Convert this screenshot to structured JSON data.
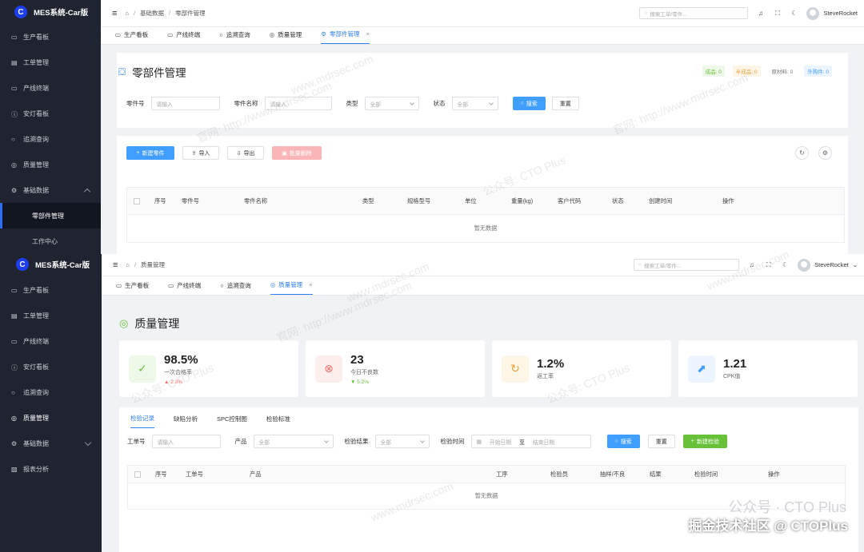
{
  "app_title": "MES系统-Car版",
  "logo_letter": "C",
  "colors": {
    "accent": "#409eff",
    "sidebar": "#1f2430",
    "success": "#67c23a",
    "danger": "#f56c6c"
  },
  "search_placeholder": "搜索工单/零件...",
  "user_name": "SteveRocket",
  "w1": {
    "sidebar": [
      {
        "label": "生产看板",
        "icon": "monitor-icon"
      },
      {
        "label": "工单管理",
        "icon": "document-icon"
      },
      {
        "label": "产线终端",
        "icon": "screen-icon"
      },
      {
        "label": "安灯看板",
        "icon": "alert-icon"
      },
      {
        "label": "追溯查询",
        "icon": "search-icon"
      },
      {
        "label": "质量管理",
        "icon": "check-circle-icon"
      },
      {
        "label": "基础数据",
        "icon": "gear-icon"
      }
    ],
    "sub_items": [
      "零部件管理",
      "工作中心"
    ],
    "breadcrumb": [
      "基础数据",
      "零部件管理"
    ],
    "tabs": [
      "生产看板",
      "产线终端",
      "追溯查询",
      "质量管理",
      "零部件管理"
    ],
    "page_title": "零部件管理",
    "stats": [
      {
        "label": "成品: 0",
        "color": "#67c23a",
        "bg": "#eef8e8"
      },
      {
        "label": "半成品: 0",
        "color": "#e6a23c",
        "bg": "#fdf5e6"
      },
      {
        "label": "原材料: 0",
        "color": "#777777",
        "bg": "#ffffff"
      },
      {
        "label": "外购件: 0",
        "color": "#409eff",
        "bg": "#ecf5ff"
      }
    ],
    "filters": {
      "part_no": {
        "label": "零件号",
        "placeholder": "请输入"
      },
      "part_name": {
        "label": "零件名称",
        "placeholder": "请输入"
      },
      "type": {
        "label": "类型",
        "value": "全部"
      },
      "status": {
        "label": "状态",
        "value": "全部"
      },
      "search_btn": "搜索",
      "reset_btn": "重置"
    },
    "actions": {
      "new": "新建零件",
      "import": "导入",
      "export": "导出",
      "batch_delete": "批量删除"
    },
    "columns": [
      "序号",
      "零件号",
      "零件名称",
      "类型",
      "规格型号",
      "单位",
      "重量(kg)",
      "客户代码",
      "状态",
      "创建时间",
      "操作"
    ],
    "empty_text": "暂无数据"
  },
  "w2": {
    "sidebar": [
      {
        "label": "生产看板",
        "icon": "monitor-icon"
      },
      {
        "label": "工单管理",
        "icon": "document-icon"
      },
      {
        "label": "产线终端",
        "icon": "screen-icon"
      },
      {
        "label": "安灯看板",
        "icon": "alert-icon"
      },
      {
        "label": "追溯查询",
        "icon": "search-icon"
      },
      {
        "label": "质量管理",
        "icon": "check-circle-icon"
      },
      {
        "label": "基础数据",
        "icon": "gear-icon"
      },
      {
        "label": "报表分析",
        "icon": "chart-icon"
      }
    ],
    "breadcrumb": [
      "质量管理"
    ],
    "tabs": [
      "生产看板",
      "产线终端",
      "追溯查询",
      "质量管理"
    ],
    "page_title": "质量管理",
    "kpis": [
      {
        "value": "98.5%",
        "label": "一次合格率",
        "trend": "2.3%",
        "dir": "up",
        "icon": "check-circle-icon",
        "fg": "#67c23a",
        "bg": "#eef8e8"
      },
      {
        "value": "23",
        "label": "今日不良数",
        "trend": "5.2%",
        "dir": "down",
        "icon": "close-circle-icon",
        "fg": "#f56c6c",
        "bg": "#fdeeee"
      },
      {
        "value": "1.2%",
        "label": "返工率",
        "trend": "",
        "dir": "",
        "icon": "refresh-icon",
        "fg": "#e6a23c",
        "bg": "#fdf5e6"
      },
      {
        "value": "1.21",
        "label": "CPK值",
        "trend": "",
        "dir": "",
        "icon": "trend-chart-icon",
        "fg": "#409eff",
        "bg": "#ecf5ff"
      }
    ],
    "sub_tabs": [
      "检验记录",
      "缺陷分析",
      "SPC控制图",
      "检验标准"
    ],
    "filters": {
      "order": {
        "label": "工单号",
        "placeholder": "请输入"
      },
      "product": {
        "label": "产品",
        "value": "全部"
      },
      "result": {
        "label": "检验结果",
        "value": "全部"
      },
      "time": {
        "label": "检验时间",
        "start": "开始日期",
        "to": "至",
        "end": "结束日期"
      },
      "search_btn": "搜索",
      "reset_btn": "重置",
      "new_btn": "新建检验"
    },
    "columns": [
      "序号",
      "工单号",
      "产品",
      "工序",
      "检验员",
      "抽样/不良",
      "结果",
      "检验时间",
      "操作"
    ],
    "empty_text": "暂无数据"
  },
  "watermarks": [
    "www.mdrsec.com",
    "官网: http://www.mdrsec.com",
    "公众号: CTO Plus"
  ],
  "footer": {
    "brand": "公众号 · CTO Plus",
    "site": "掘金技术社区 @ CTOPlus"
  }
}
